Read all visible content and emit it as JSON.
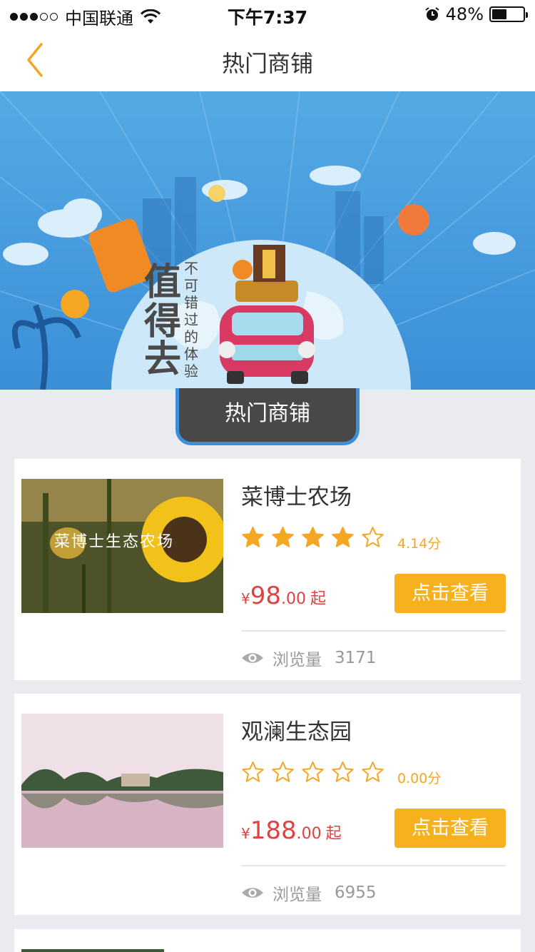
{
  "status_bar": {
    "carrier": "中国联通",
    "time": "下午7:37",
    "battery_percent": "48%",
    "battery_level": 0.48,
    "signal_bars": 3
  },
  "nav": {
    "back_icon": "chevron-left-icon",
    "title": "热门商铺"
  },
  "banner": {
    "headline": "值得去",
    "tagline": "不可错过的体验",
    "watermark_text": "菜博士生态农场"
  },
  "section_tab": {
    "label": "热门商铺"
  },
  "shops": [
    {
      "name": "菜博士农场",
      "image_caption": "菜博士生态农场",
      "rating": 4.14,
      "score_text": "4.14分",
      "price_currency": "¥",
      "price_int": "98",
      "price_dec": ".00",
      "price_suffix": "起",
      "button_label": "点击查看",
      "views_label": "浏览量",
      "views_count": "3171"
    },
    {
      "name": "观澜生态园",
      "image_caption": "",
      "rating": 0,
      "score_text": "0.00分",
      "price_currency": "¥",
      "price_int": "188",
      "price_dec": ".00",
      "price_suffix": "起",
      "button_label": "点击查看",
      "views_label": "浏览量",
      "views_count": "6955"
    }
  ],
  "colors": {
    "accent": "#f7b11f",
    "price": "#e24141",
    "star": "#f5a623",
    "banner_blue": "#4a9fe0",
    "tab_dark": "#484848"
  }
}
